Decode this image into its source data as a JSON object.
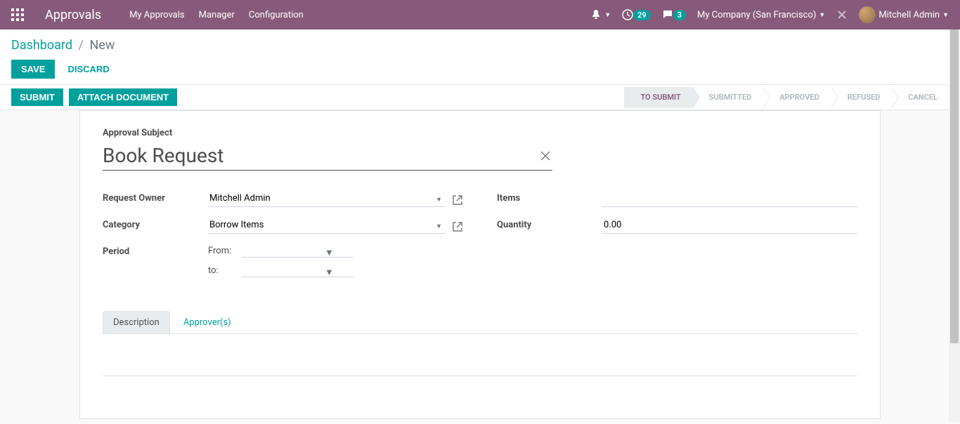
{
  "navbar": {
    "app_title": "Approvals",
    "menu": [
      "My Approvals",
      "Manager",
      "Configuration"
    ],
    "clock_badge": "29",
    "chat_badge": "3",
    "company": "My Company (San Francisco)",
    "user": "Mitchell Admin"
  },
  "breadcrumb": {
    "parent": "Dashboard",
    "current": "New",
    "save": "Save",
    "discard": "Discard"
  },
  "actions": {
    "submit": "Submit",
    "attach": "Attach Document"
  },
  "status": {
    "steps": [
      "To Submit",
      "Submitted",
      "Approved",
      "Refused",
      "Cancel"
    ],
    "active_index": 0
  },
  "form": {
    "subject_label": "Approval Subject",
    "subject_value": "Book Request",
    "left": {
      "request_owner_label": "Request Owner",
      "request_owner_value": "Mitchell Admin",
      "category_label": "Category",
      "category_value": "Borrow Items",
      "period_label": "Period",
      "period_from_label": "From:",
      "period_from_value": "",
      "period_to_label": "to:",
      "period_to_value": ""
    },
    "right": {
      "items_label": "Items",
      "items_value": "",
      "quantity_label": "Quantity",
      "quantity_value": "0.00"
    }
  },
  "tabs": {
    "description": "Description",
    "approvers": "Approver(s)"
  }
}
